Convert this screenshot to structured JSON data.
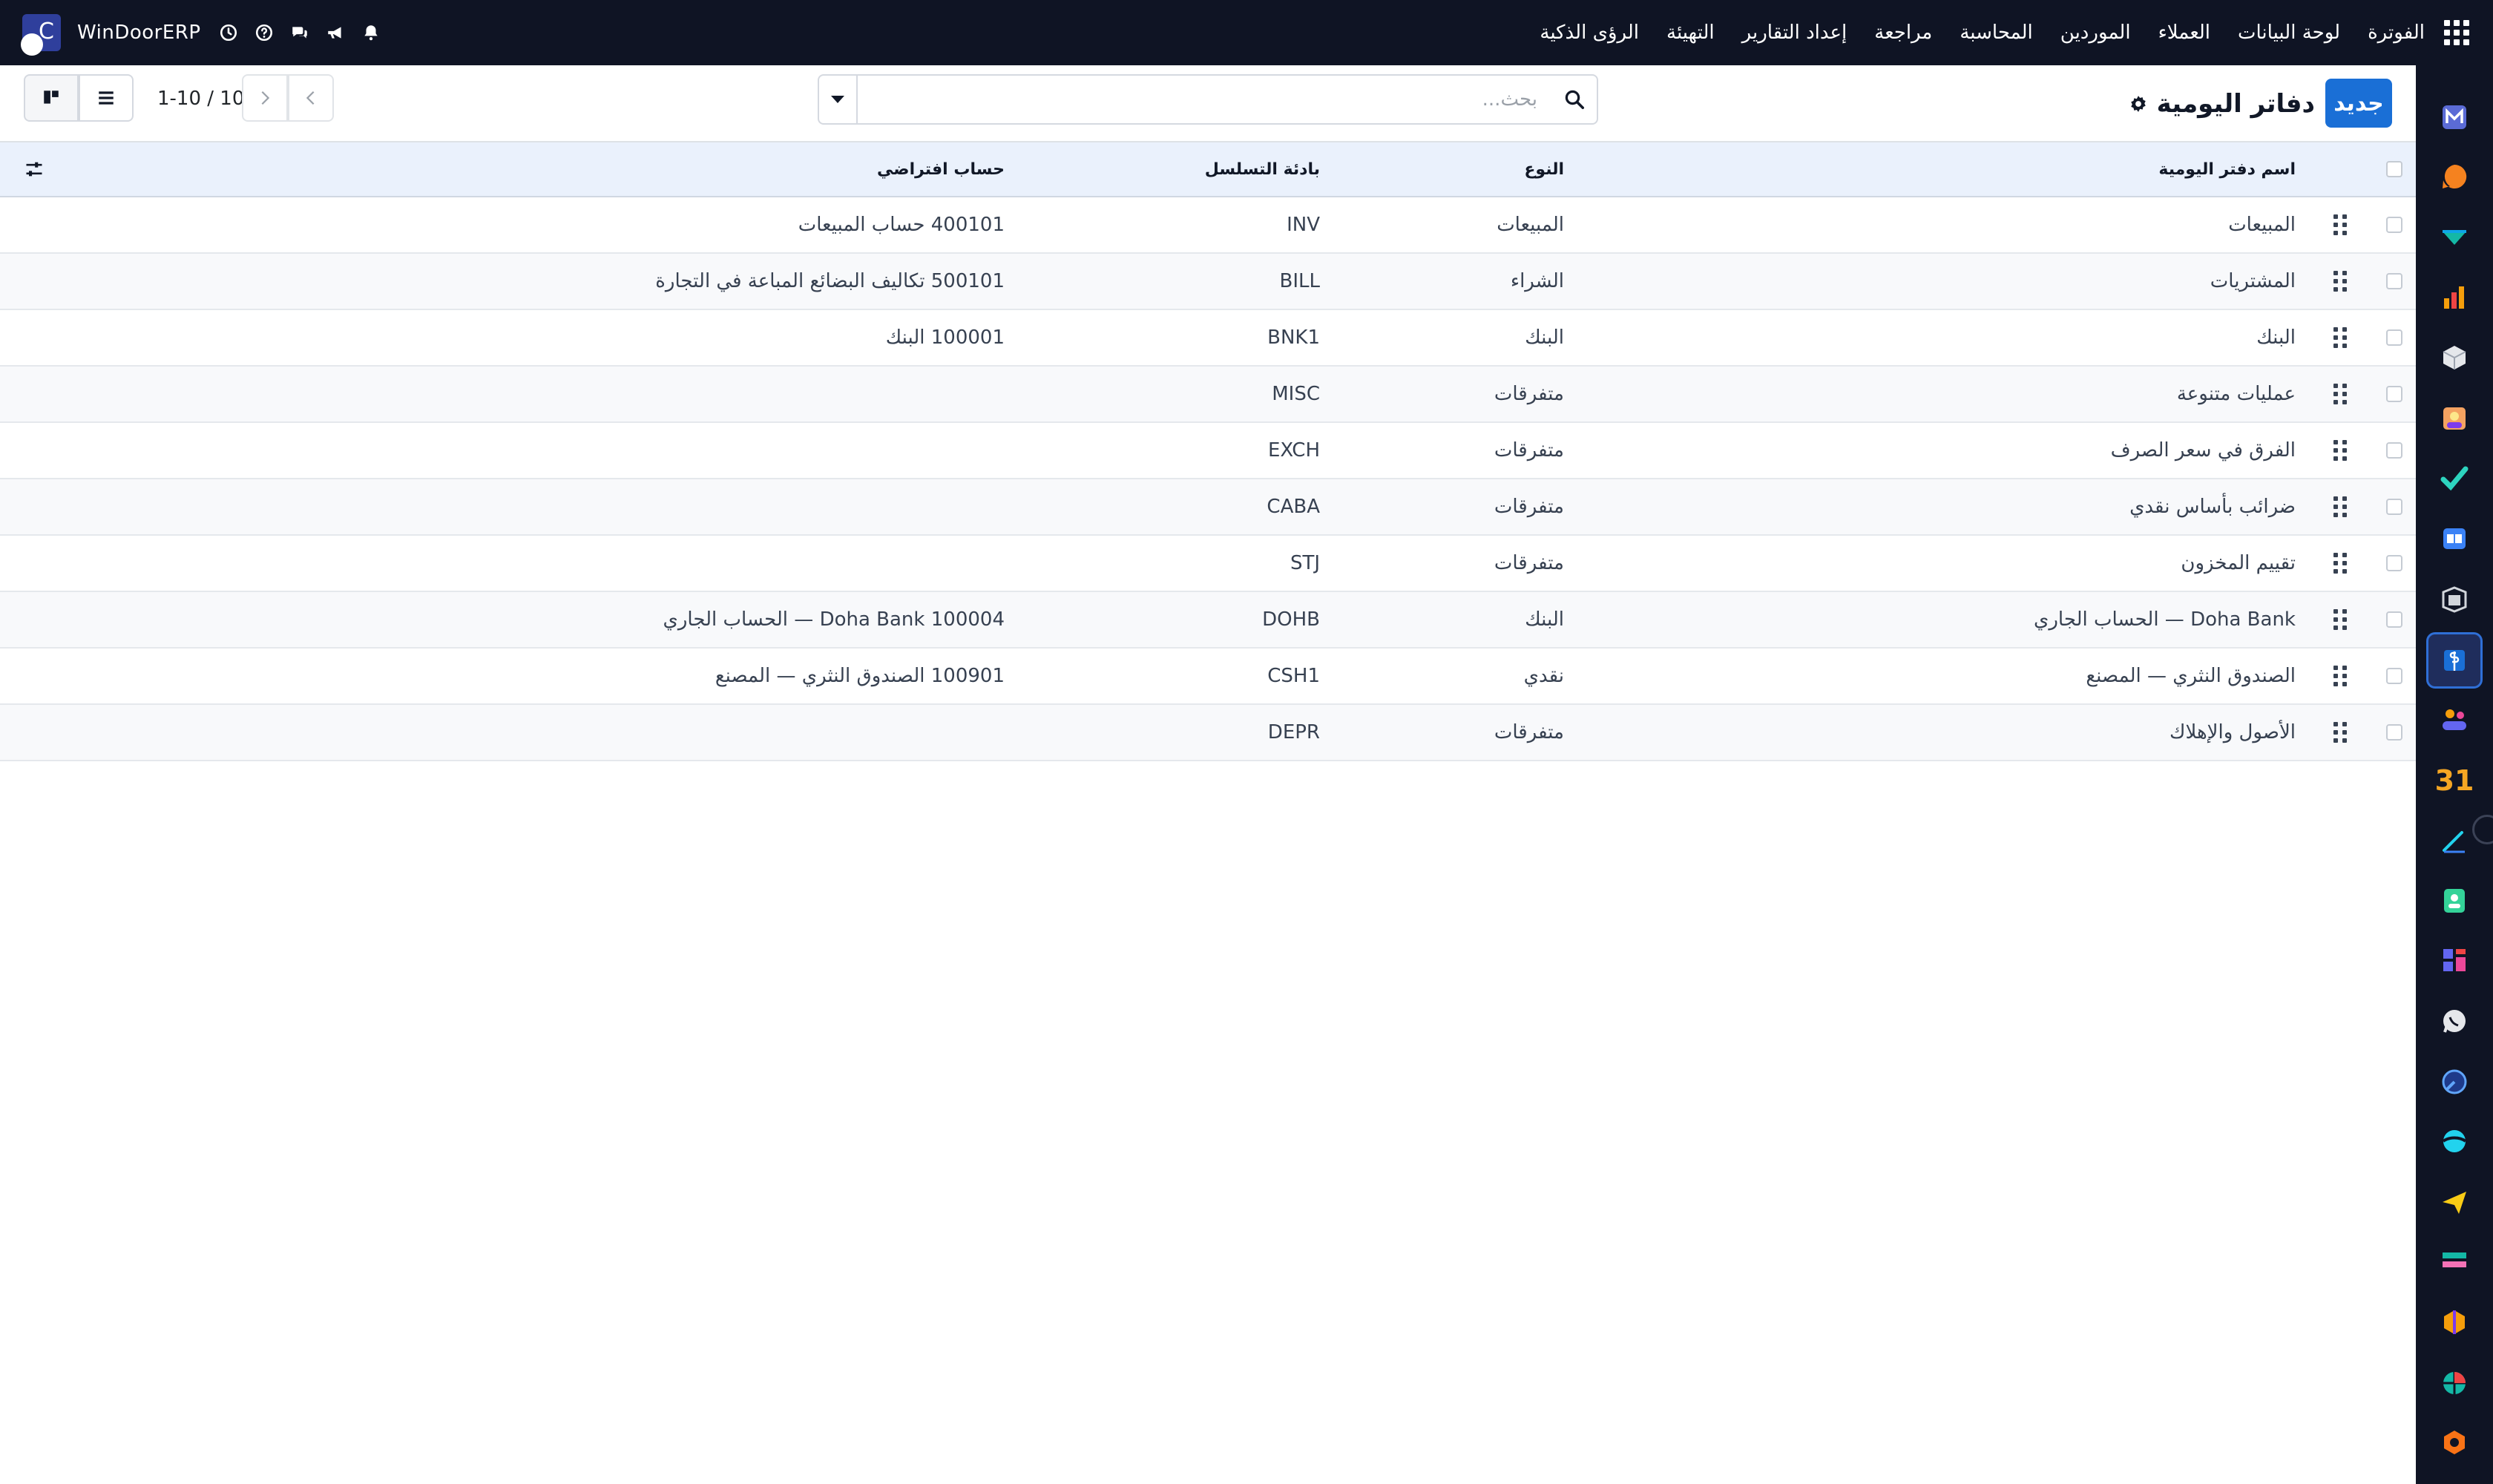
{
  "navbar": {
    "menu": [
      "الفوترة",
      "لوحة البيانات",
      "العملاء",
      "الموردين",
      "المحاسبة",
      "مراجعة",
      "إعداد التقارير",
      "التهيئة",
      "الرؤى الذكية"
    ],
    "company_name": "WinDoorERP",
    "company_logo_letter": "C",
    "systray_icons": [
      "clock-icon",
      "help-icon",
      "chat-icon",
      "megaphone-icon",
      "bell-icon"
    ]
  },
  "control_panel": {
    "new_button_label": "جديد",
    "title": "دفاتر اليومية",
    "search_placeholder": "بحث...",
    "pager": "1-10 / 10"
  },
  "table": {
    "columns": {
      "name": "اسم دفتر اليومية",
      "type": "النوع",
      "code": "بادئة التسلسل",
      "account": "حساب افتراضي"
    },
    "rows": [
      {
        "name": "المبيعات",
        "type": "المبيعات",
        "code": "INV",
        "account": "400101 حساب المبيعات"
      },
      {
        "name": "المشتريات",
        "type": "الشراء",
        "code": "BILL",
        "account": "500101 تكاليف البضائع المباعة في التجارة"
      },
      {
        "name": "البنك",
        "type": "البنك",
        "code": "BNK1",
        "account": "100001 البنك"
      },
      {
        "name": "عمليات متنوعة",
        "type": "متفرقات",
        "code": "MISC",
        "account": ""
      },
      {
        "name": "الفرق في سعر الصرف",
        "type": "متفرقات",
        "code": "EXCH",
        "account": ""
      },
      {
        "name": "ضرائب بأساس نقدي",
        "type": "متفرقات",
        "code": "CABA",
        "account": ""
      },
      {
        "name": "تقييم المخزون",
        "type": "متفرقات",
        "code": "STJ",
        "account": ""
      },
      {
        "name": "Doha Bank — الحساب الجاري",
        "type": "البنك",
        "code": "DOHB",
        "account": "Doha Bank 100004 — الحساب الجاري"
      },
      {
        "name": "الصندوق النثري — المصنع",
        "type": "نقدي",
        "code": "CSH1",
        "account": "100901 الصندوق النثري — المصنع"
      },
      {
        "name": "الأصول والإهلاك",
        "type": "متفرقات",
        "code": "DEPR",
        "account": ""
      }
    ]
  },
  "sidebar_apps": [
    {
      "name": "mail-app-icon",
      "color": "#5b6bd6"
    },
    {
      "name": "discuss-app-icon",
      "color": "#f5821f"
    },
    {
      "name": "crm-app-icon",
      "color": "#14b8a6"
    },
    {
      "name": "reporting-app-icon",
      "color": "#f59e0b"
    },
    {
      "name": "inventory-app-icon",
      "color": "#e5e7eb"
    },
    {
      "name": "contacts-app-icon",
      "color": "#f4a261"
    },
    {
      "name": "todo-app-icon",
      "color": "#2dd4bf"
    },
    {
      "name": "knowledge-app-icon",
      "color": "#3b82f6"
    },
    {
      "name": "products-app-icon",
      "color": "#d1d5db"
    },
    {
      "name": "invoicing-app-icon",
      "color": "#1a6fd6"
    },
    {
      "name": "employees-app-icon",
      "color": "#f59e0b"
    },
    {
      "name": "calendar-app-icon",
      "color": "#f5a623",
      "text": "31"
    },
    {
      "name": "sign-app-icon",
      "color": "#22d3ee"
    },
    {
      "name": "contacts-card-app-icon",
      "color": "#34d399"
    },
    {
      "name": "dashboard-app-icon",
      "color": "#6366f1"
    },
    {
      "name": "whatsapp-app-icon",
      "color": "#e5e7eb"
    },
    {
      "name": "timesheet-app-icon",
      "color": "#60a5fa"
    },
    {
      "name": "website-app-icon",
      "color": "#22d3ee"
    },
    {
      "name": "email-marketing-app-icon",
      "color": "#facc15"
    },
    {
      "name": "payroll-app-icon",
      "color": "#f472b6"
    },
    {
      "name": "manufacturing-app-icon",
      "color": "#f59e0b"
    },
    {
      "name": "spreadsheet-app-icon",
      "color": "#14b8a6"
    },
    {
      "name": "settings-app-icon",
      "color": "#f97316"
    }
  ],
  "colors": {
    "navbar_bg": "#0f1424",
    "primary": "#1a6fd6",
    "header_bg": "#eaf1fc"
  }
}
